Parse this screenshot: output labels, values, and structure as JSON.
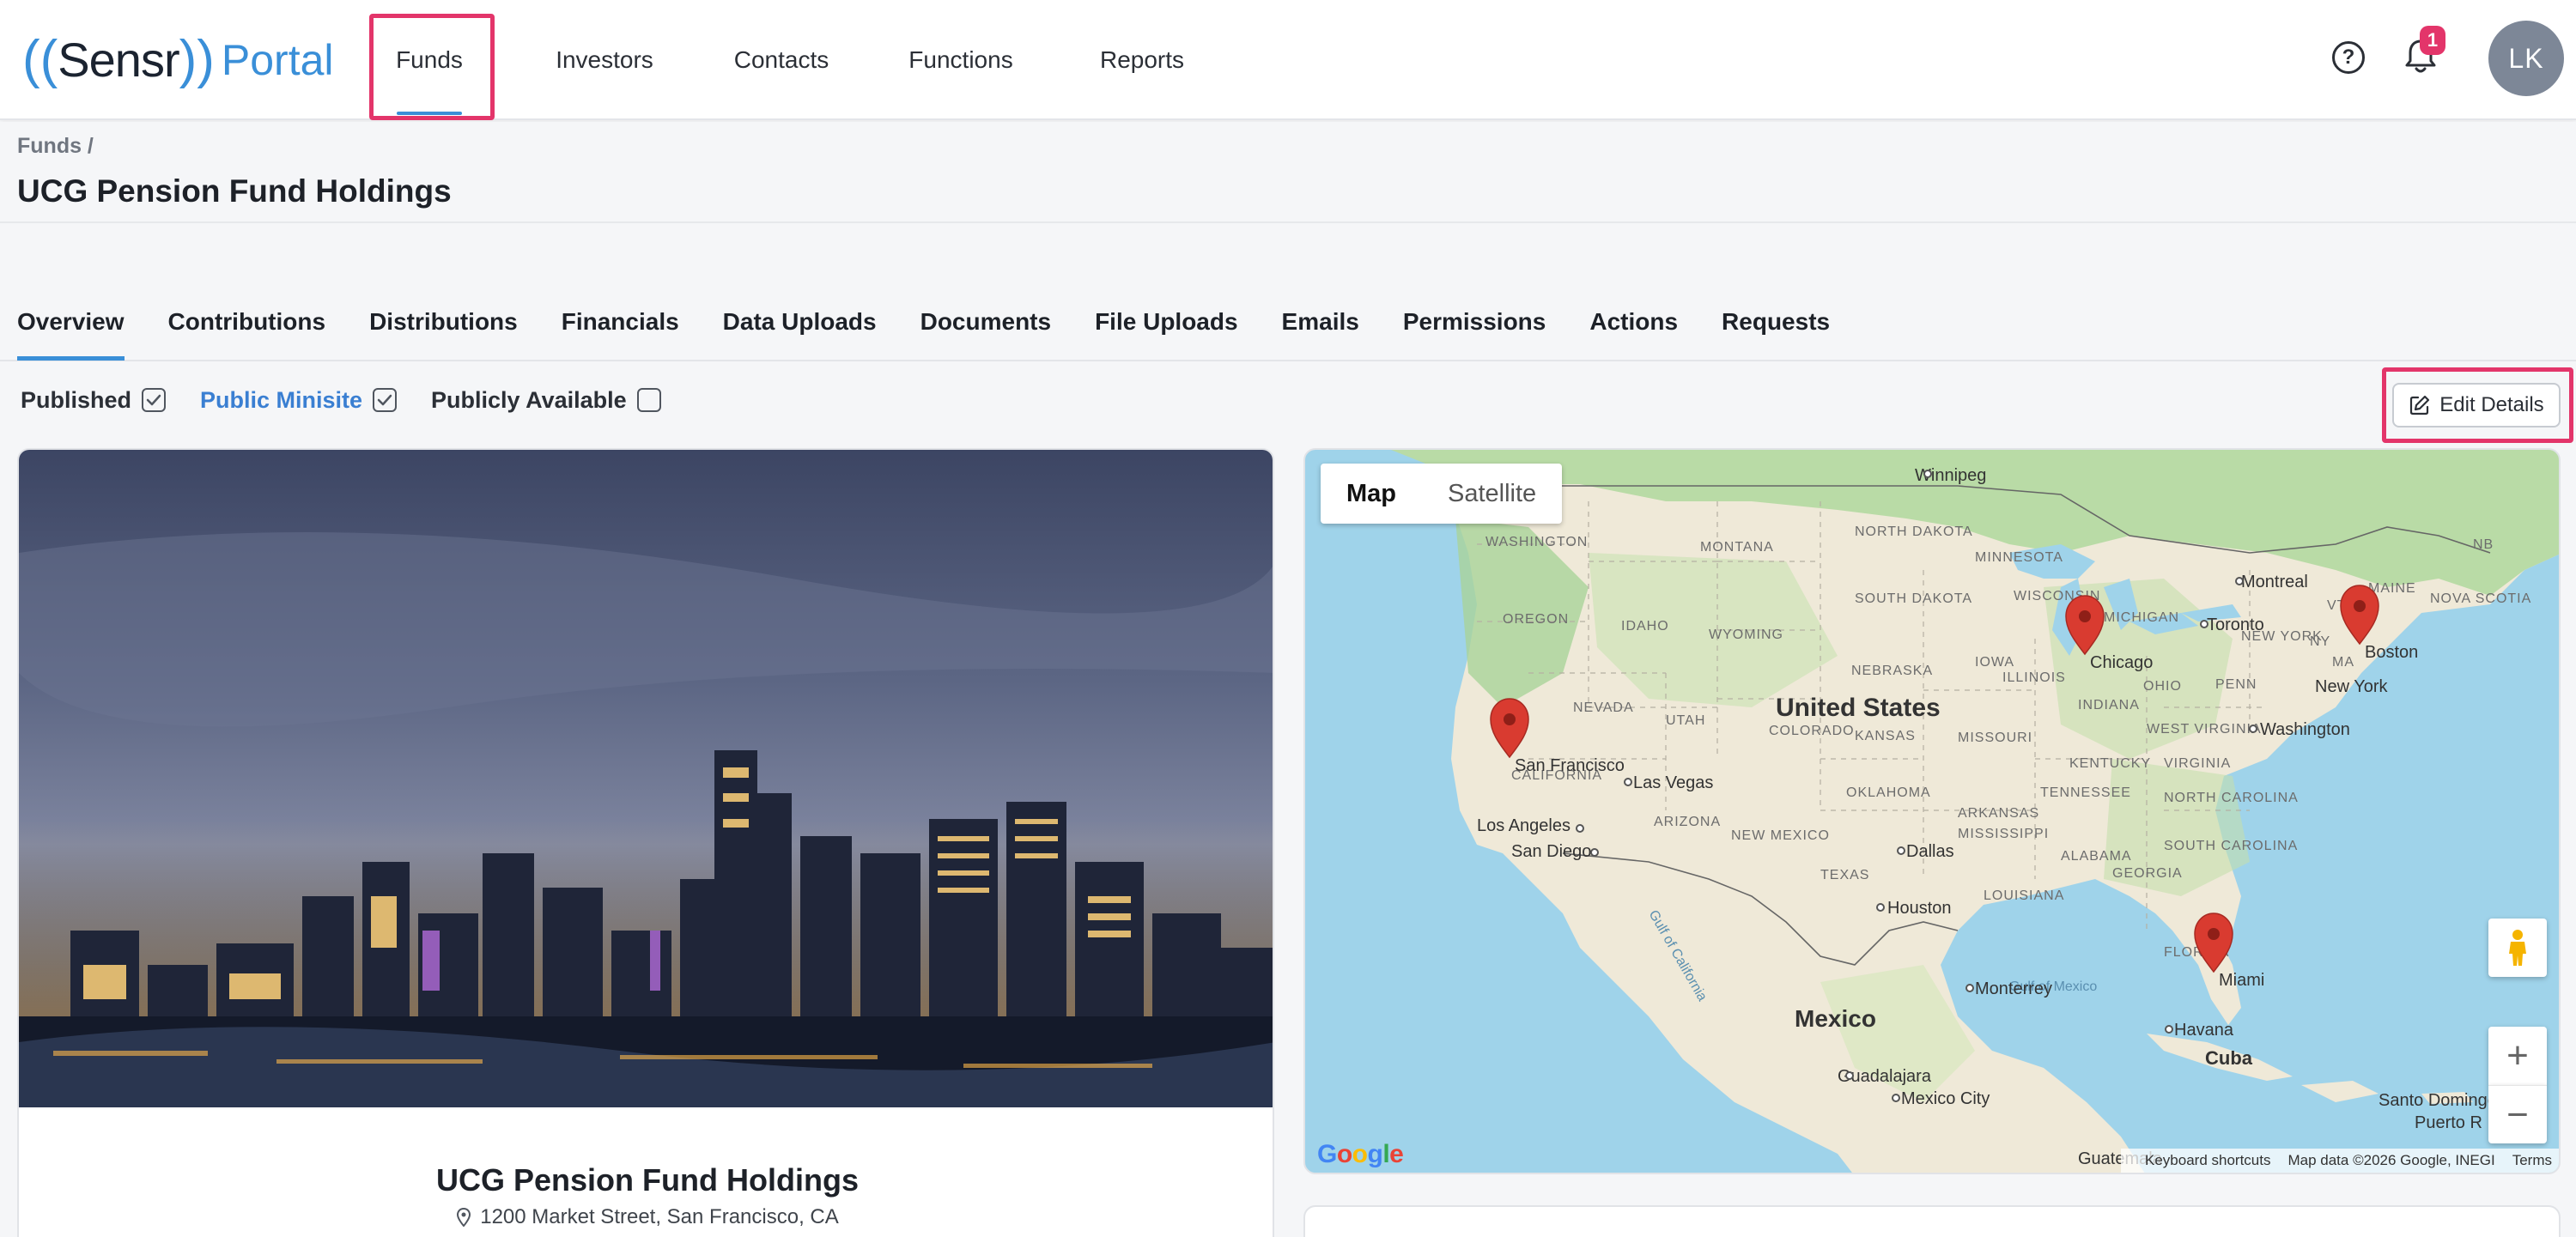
{
  "logo": {
    "name": "Sensr",
    "suffix": "Portal"
  },
  "nav": {
    "items": [
      {
        "label": "Funds",
        "active": true
      },
      {
        "label": "Investors"
      },
      {
        "label": "Contacts"
      },
      {
        "label": "Functions"
      },
      {
        "label": "Reports"
      }
    ]
  },
  "header_icons": {
    "help": "help-icon",
    "notifications": "bell-icon",
    "notification_count": "1",
    "avatar_initials": "LK"
  },
  "breadcrumb": "Funds /",
  "page_title": "UCG Pension Fund Holdings",
  "tabs": [
    {
      "label": "Overview",
      "active": true
    },
    {
      "label": "Contributions"
    },
    {
      "label": "Distributions"
    },
    {
      "label": "Financials"
    },
    {
      "label": "Data Uploads"
    },
    {
      "label": "Documents"
    },
    {
      "label": "File Uploads"
    },
    {
      "label": "Emails"
    },
    {
      "label": "Permissions"
    },
    {
      "label": "Actions"
    },
    {
      "label": "Requests"
    }
  ],
  "flags": [
    {
      "label": "Published",
      "checked": true
    },
    {
      "label": "Public Minisite",
      "checked": true,
      "link": true
    },
    {
      "label": "Publicly Available",
      "checked": false
    }
  ],
  "edit_button": "Edit Details",
  "fund_card": {
    "name": "UCG Pension Fund Holdings",
    "address": "1200 Market Street, San Francisco, CA"
  },
  "map": {
    "type_options": [
      "Map",
      "Satellite"
    ],
    "selected_type": "Map",
    "zoom_in": "+",
    "zoom_out": "−",
    "footer": [
      "Keyboard shortcuts",
      "Map data ©2026 Google, INEGI",
      "Terms"
    ],
    "logo_text": "Google",
    "markers": [
      "San Francisco",
      "Chicago",
      "Boston",
      "Miami"
    ],
    "labels": {
      "country_us": "United States",
      "country_mx": "Mexico",
      "country_cu": "Cuba",
      "cities": [
        "Winnipeg",
        "Montreal",
        "Toronto",
        "New York",
        "Washington",
        "Las Vegas",
        "Los Angeles",
        "San Diego",
        "Dallas",
        "Houston",
        "Monterrey",
        "Guadalajara",
        "Mexico City",
        "Havana",
        "Guatemala",
        "Santo Domingo",
        "Puerto R"
      ],
      "states": [
        "WASHINGTON",
        "MONTANA",
        "NORTH DAKOTA",
        "MINNESOTA",
        "OREGON",
        "IDAHO",
        "WYOMING",
        "SOUTH DAKOTA",
        "WISCONSIN",
        "MICHIGAN",
        "NEVADA",
        "UTAH",
        "COLORADO",
        "NEBRASKA",
        "IOWA",
        "ILLINOIS",
        "INDIANA",
        "OHIO",
        "PENN",
        "CALIFORNIA",
        "ARIZONA",
        "NEW MEXICO",
        "KANSAS",
        "MISSOURI",
        "KENTUCKY",
        "WEST VIRGINIA",
        "VIRGINIA",
        "OKLAHOMA",
        "ARKANSAS",
        "TENNESSEE",
        "NORTH CAROLINA",
        "TEXAS",
        "MISSISSIPPI",
        "ALABAMA",
        "SOUTH CAROLINA",
        "LOUISIANA",
        "GEORGIA",
        "FLORIDA",
        "MAINE",
        "NOVA SCOTIA",
        "NB",
        "VT",
        "MA",
        "NY",
        "NEW YORK",
        "TENNESSEE"
      ],
      "water": [
        "Gulf of Mexico",
        "Gulf of California"
      ]
    }
  },
  "colors": {
    "accent": "#3a8fd8",
    "highlight": "#e3356a",
    "marker": "#d93b30"
  }
}
